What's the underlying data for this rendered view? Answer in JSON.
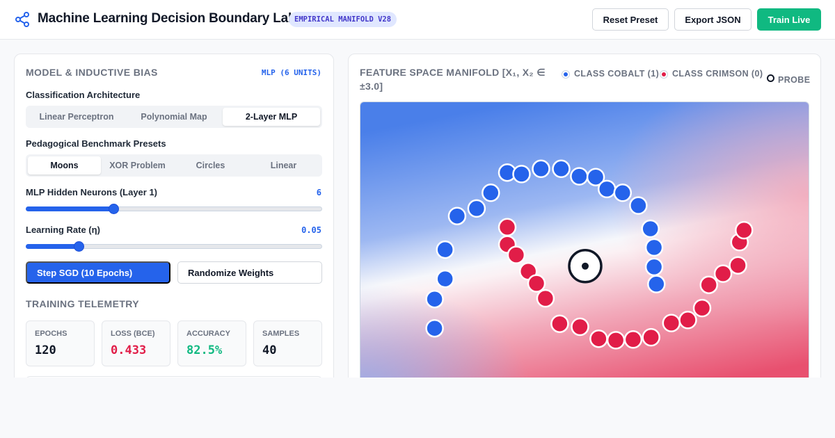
{
  "app": {
    "title": "Machine Learning Decision Boundary Lab",
    "badge": "EMPIRICAL MANIFOLD V28",
    "actions": {
      "reset": "Reset Preset",
      "export": "Export JSON",
      "train": "Train Live"
    }
  },
  "model": {
    "title": "MODEL & INDUCTIVE BIAS",
    "tag": "MLP (6 UNITS)",
    "architecture_label": "Classification Architecture",
    "architectures": [
      "Linear Perceptron",
      "Polynomial Map",
      "2-Layer MLP"
    ],
    "architecture_selected": 2,
    "presets_label": "Pedagogical Benchmark Presets",
    "presets": [
      "Moons",
      "XOR Problem",
      "Circles",
      "Linear"
    ],
    "preset_selected": 0,
    "neurons": {
      "label": "MLP Hidden Neurons (Layer 1)",
      "value": "6",
      "fraction": 0.295
    },
    "learning_rate": {
      "label": "Learning Rate (η)",
      "value": "0.05",
      "fraction": 0.179
    },
    "step_button": "Step SGD (10 Epochs)",
    "randomize_button": "Randomize Weights"
  },
  "telemetry": {
    "title": "TRAINING TELEMETRY",
    "stats": [
      {
        "label": "EPOCHS",
        "value": "120"
      },
      {
        "label": "LOSS (BCE)",
        "value": "0.433"
      },
      {
        "label": "ACCURACY",
        "value": "82.5%"
      },
      {
        "label": "SAMPLES",
        "value": "40"
      }
    ]
  },
  "manifold": {
    "title": "FEATURE SPACE MANIFOLD [X₁, X₂ ∈ ±3.0]",
    "legend": [
      {
        "label": "CLASS COBALT (1)",
        "color": "#2563eb"
      },
      {
        "label": "CLASS CRIMSON (0)",
        "color": "#e11d48"
      },
      {
        "label": "PROBE",
        "color": "#111827"
      }
    ],
    "colors": {
      "cobalt": "#2563eb",
      "crimson": "#e11d48"
    }
  },
  "chart_data": {
    "type": "scatter",
    "xlim": [
      -3,
      3
    ],
    "ylim": [
      -3,
      3
    ],
    "series": [
      {
        "name": "CLASS COBALT (1)",
        "color": "#2563eb",
        "points": [
          [
            -2.01,
            -0.02
          ],
          [
            -2.01,
            0.37
          ],
          [
            -1.87,
            0.64
          ],
          [
            -1.87,
            1.03
          ],
          [
            -1.71,
            1.48
          ],
          [
            -1.45,
            1.58
          ],
          [
            -1.26,
            1.79
          ],
          [
            -1.04,
            2.06
          ],
          [
            -0.85,
            2.04
          ],
          [
            -0.59,
            2.11
          ],
          [
            -0.32,
            2.11
          ],
          [
            -0.08,
            2.01
          ],
          [
            0.14,
            2.0
          ],
          [
            0.29,
            1.84
          ],
          [
            0.5,
            1.79
          ],
          [
            0.71,
            1.62
          ],
          [
            0.87,
            1.31
          ],
          [
            0.92,
            1.06
          ],
          [
            0.92,
            0.8
          ],
          [
            0.95,
            0.57
          ]
        ]
      },
      {
        "name": "CLASS CRIMSON (0)",
        "color": "#e11d48",
        "points": [
          [
            -1.04,
            1.33
          ],
          [
            -1.04,
            1.1
          ],
          [
            -0.92,
            0.96
          ],
          [
            -0.76,
            0.74
          ],
          [
            -0.65,
            0.58
          ],
          [
            -0.53,
            0.38
          ],
          [
            -0.34,
            0.04
          ],
          [
            -0.07,
            0.0
          ],
          [
            0.18,
            -0.16
          ],
          [
            0.41,
            -0.18
          ],
          [
            0.64,
            -0.17
          ],
          [
            0.88,
            -0.14
          ],
          [
            1.15,
            0.05
          ],
          [
            1.37,
            0.09
          ],
          [
            1.56,
            0.25
          ],
          [
            1.65,
            0.56
          ],
          [
            1.84,
            0.71
          ],
          [
            2.04,
            0.82
          ],
          [
            2.06,
            1.13
          ],
          [
            2.12,
            1.29
          ]
        ]
      }
    ],
    "probe": [
      0.0,
      0.81
    ]
  }
}
